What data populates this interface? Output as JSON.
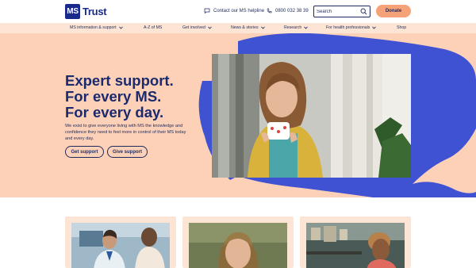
{
  "brand": {
    "logo_mark": "MS",
    "logo_word": "Trust",
    "primary_color": "#1a2a8c",
    "accent_color": "#f6a278",
    "hero_bg": "#fcd1b8"
  },
  "header": {
    "helpline_label": "Contact our MS helpline",
    "helpline_icon": "chat-bubble-icon",
    "phone_number": "0800 032 38 39",
    "phone_icon": "phone-icon",
    "search_placeholder": "Search",
    "search_icon": "search-icon",
    "donate_label": "Donate"
  },
  "nav": {
    "items": [
      {
        "label": "MS information & support",
        "has_dropdown": true
      },
      {
        "label": "A-Z of MS",
        "has_dropdown": false
      },
      {
        "label": "Get involved",
        "has_dropdown": true
      },
      {
        "label": "News & stories",
        "has_dropdown": true
      },
      {
        "label": "Research",
        "has_dropdown": true
      },
      {
        "label": "For health professionals",
        "has_dropdown": true
      },
      {
        "label": "Shop",
        "has_dropdown": false
      }
    ]
  },
  "hero": {
    "headline_line1": "Expert support.",
    "headline_line2": "For every MS.",
    "headline_line3": "For every day.",
    "subtext": "We exist to give everyone living with MS the knowledge and confidence they need to feel more in control of their MS today and every day.",
    "button_primary": "Get support",
    "button_secondary": "Give support",
    "photo_subject": "woman-with-mug-photo"
  },
  "cards": [
    {
      "image": "nurse-consultation-photo"
    },
    {
      "image": "woman-portrait-photo"
    },
    {
      "image": "man-outdoors-photo"
    }
  ]
}
